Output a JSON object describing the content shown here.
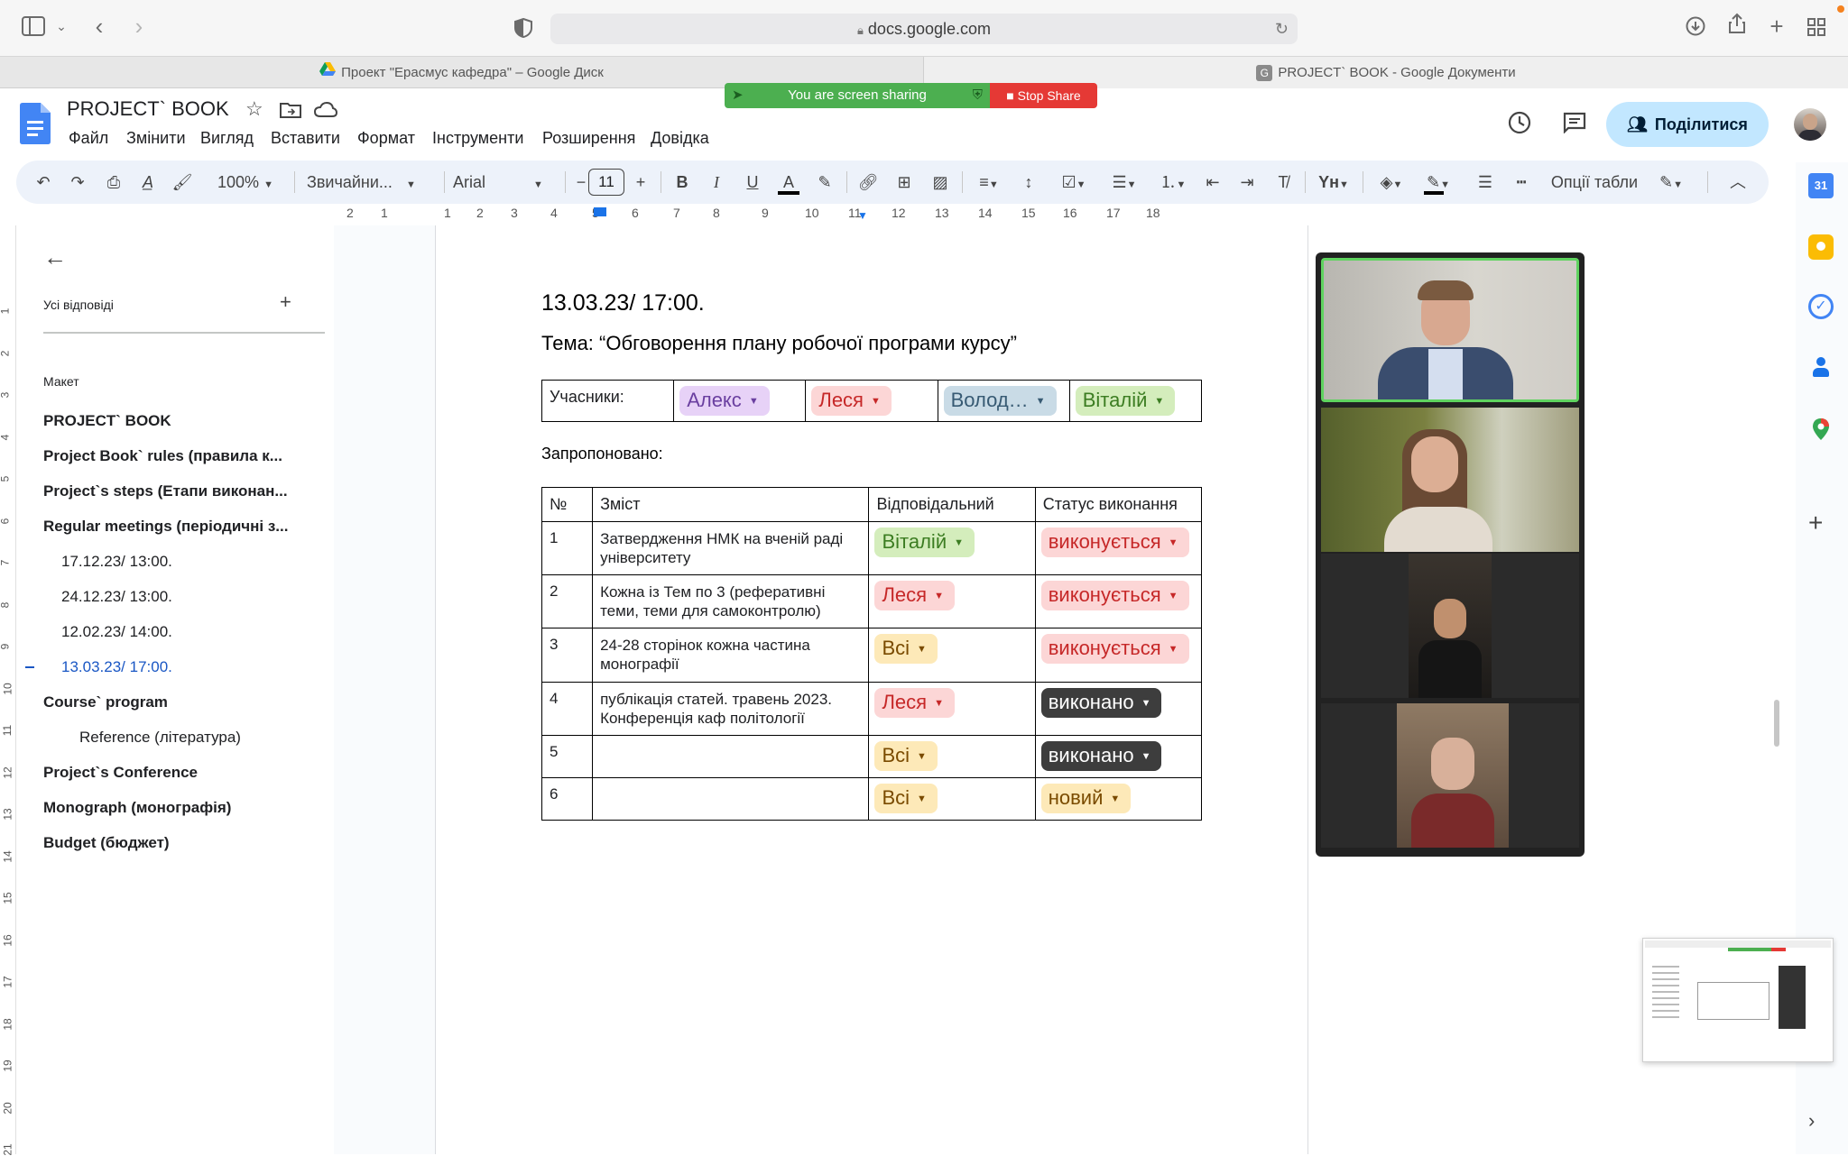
{
  "browser": {
    "url": "docs.google.com",
    "tabs": [
      {
        "title": "Проект \"Ерасмус кафедра\" – Google Диск",
        "icon": "google-drive-icon"
      },
      {
        "title": "PROJECT` BOOK - Google Документи",
        "icon": "google-docs-icon"
      }
    ]
  },
  "sharing": {
    "status": "You are screen sharing",
    "stop_label": "Stop Share",
    "stop_color": "#e53935",
    "banner_color": "#4caf50"
  },
  "doc": {
    "title": "PROJECT` BOOK",
    "menu": [
      "Файл",
      "Змінити",
      "Вигляд",
      "Вставити",
      "Формат",
      "Інструменти",
      "Розширення",
      "Довідка"
    ],
    "share_label": "Поділитися"
  },
  "toolbar": {
    "zoom": "100%",
    "style": "Звичайни...",
    "font": "Arial",
    "font_size": "11",
    "table_options": "Опції табли"
  },
  "ruler": {
    "marks": [
      "2",
      "1",
      "1",
      "2",
      "3",
      "4",
      "5",
      "6",
      "7",
      "8",
      "9",
      "10",
      "11",
      "12",
      "13",
      "14",
      "15",
      "16",
      "17",
      "18"
    ]
  },
  "vruler": {
    "marks": [
      "1",
      "2",
      "3",
      "4",
      "5",
      "6",
      "7",
      "8",
      "9",
      "10",
      "11",
      "12",
      "13",
      "14",
      "15",
      "16",
      "17",
      "18",
      "19",
      "20",
      "21"
    ]
  },
  "outline": {
    "tab_label": "Усі відповіді",
    "section_label": "Макет",
    "items": [
      {
        "label": "PROJECT` BOOK",
        "level": 1
      },
      {
        "label": "Project Book` rules (правила к...",
        "level": 1
      },
      {
        "label": "Project`s steps (Етапи виконан...",
        "level": 1
      },
      {
        "label": "Regular meetings (періодичні з...",
        "level": 1
      },
      {
        "label": "17.12.23/ 13:00.",
        "level": 2
      },
      {
        "label": "24.12.23/ 13:00.",
        "level": 2
      },
      {
        "label": "12.02.23/ 14:00.",
        "level": 2
      },
      {
        "label": "13.03.23/ 17:00.",
        "level": 2,
        "active": true
      },
      {
        "label": "Course` program",
        "level": 1
      },
      {
        "label": "Reference (література)",
        "level": 3
      },
      {
        "label": "Project`s Conference",
        "level": 1
      },
      {
        "label": "Monograph (монографія)",
        "level": 1
      },
      {
        "label": "Budget (бюджет)",
        "level": 1
      }
    ]
  },
  "content": {
    "heading": "13.03.23/ 17:00.",
    "topic": "Тема: “Обговорення плану робочої програми курсу”",
    "participants_label": "Учасники:",
    "participants": [
      {
        "name": "Алекс",
        "color": "#e7d2f7",
        "text_color": "#6a3fa0"
      },
      {
        "name": "Леся",
        "color": "#fcd6d6",
        "text_color": "#c62828"
      },
      {
        "name": "Волод…",
        "color": "#c9dbe6",
        "text_color": "#375a73"
      },
      {
        "name": "Віталій",
        "color": "#d4edbc",
        "text_color": "#3c7d22"
      }
    ],
    "proposed_label": "Запропоновано:",
    "table": {
      "headers": [
        "№",
        "Зміст",
        "Відповідальний",
        "Статус виконання"
      ],
      "rows": [
        {
          "num": "1",
          "content": "Затвердження НМК на вченій раді університету",
          "resp": "Віталій",
          "resp_color": "#d4edbc",
          "resp_text": "#3c7d22",
          "status": "виконується",
          "status_color": "#fcd6d6",
          "status_text": "#c62828"
        },
        {
          "num": "2",
          "content": "Кожна із Тем по 3 (реферативні теми, теми для самоконтролю)",
          "resp": "Леся",
          "resp_color": "#fcd6d6",
          "resp_text": "#c62828",
          "status": "виконується",
          "status_color": "#fcd6d6",
          "status_text": "#c62828"
        },
        {
          "num": "3",
          "content": "24-28 сторінок кожна частина монографії",
          "resp": "Всі",
          "resp_color": "#fde9b8",
          "resp_text": "#7a4b00",
          "status": "виконується",
          "status_color": "#fcd6d6",
          "status_text": "#c62828"
        },
        {
          "num": "4",
          "content": "публікація статей. травень 2023. Конференція каф політології",
          "resp": "Леся",
          "resp_color": "#fcd6d6",
          "resp_text": "#c62828",
          "status": "виконано",
          "status_color": "#3d3d3d",
          "status_text": "#ffffff"
        },
        {
          "num": "5",
          "content": "",
          "resp": "Всі",
          "resp_color": "#fde9b8",
          "resp_text": "#7a4b00",
          "status": "виконано",
          "status_color": "#3d3d3d",
          "status_text": "#ffffff"
        },
        {
          "num": "6",
          "content": "",
          "resp": "Всі",
          "resp_color": "#fde9b8",
          "resp_text": "#7a4b00",
          "status": "новий",
          "status_color": "#fde9b8",
          "status_text": "#7a4b00"
        }
      ]
    }
  }
}
